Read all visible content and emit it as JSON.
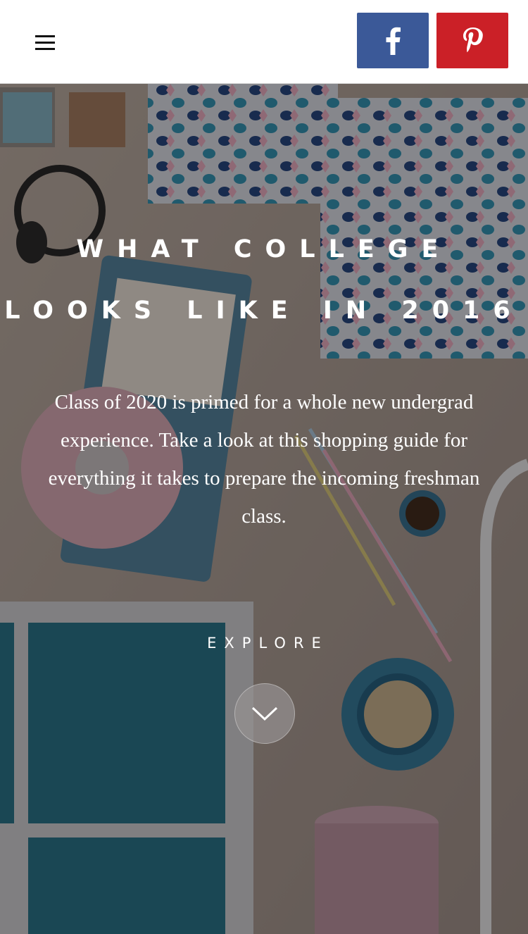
{
  "header": {
    "menu_icon": "hamburger-menu-icon",
    "share": {
      "facebook": {
        "icon": "facebook-icon",
        "color": "#3b5998"
      },
      "pinterest": {
        "icon": "pinterest-icon",
        "color": "#cb2027"
      }
    }
  },
  "hero": {
    "headline_line1": "WHAT COLLEGE",
    "headline_line2": "LOOKS LIKE IN 2016",
    "description": "Class of 2020 is primed for a whole new undergrad experience. Take a look at this shopping guide for everything it takes to prepare the incoming freshman class.",
    "explore_label": "EXPLORE",
    "scroll_icon": "chevron-down-icon"
  }
}
